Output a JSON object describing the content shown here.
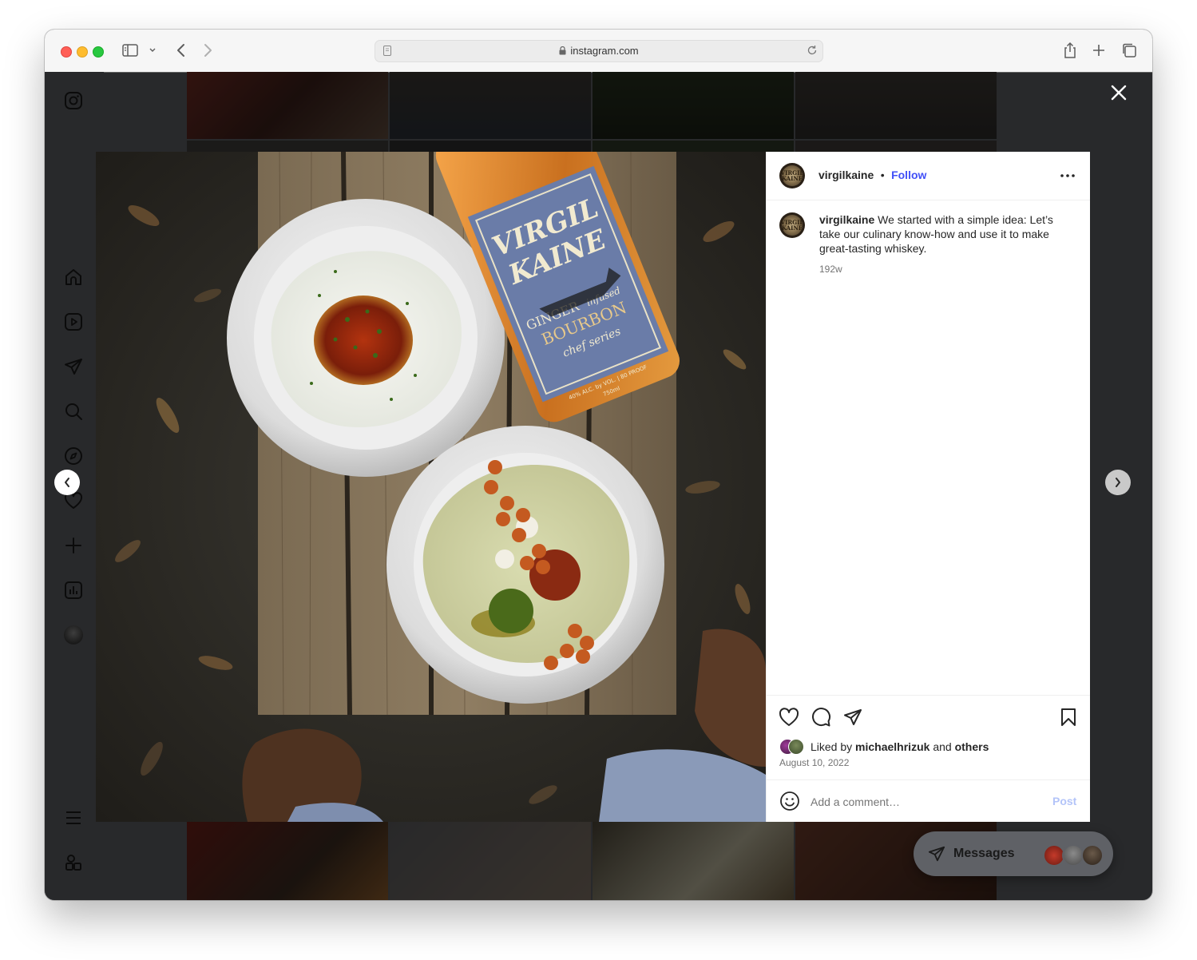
{
  "browser": {
    "url": "instagram.com"
  },
  "post": {
    "username": "virgilkaine",
    "follow_label": "Follow",
    "avatar_text": "VIRGIL KAINE",
    "caption_text": "We started with a simple idea: Let’s take our culinary know-how and use it to make great-tasting whiskey.",
    "caption_age": "192w",
    "liked_by_prefix": "Liked by",
    "liked_by_user": "michaelhrizuk",
    "liked_by_and": "and",
    "liked_by_others": "others",
    "date": "August 10, 2022",
    "comment_placeholder": "Add a comment…",
    "post_label": "Post"
  },
  "photo": {
    "bottle_label_line1": "VIRGIL",
    "bottle_label_line2": "KAINE",
    "bottle_label_line3": "GINGER",
    "bottle_label_line4": "infused",
    "bottle_label_line5": "BOURBON",
    "bottle_label_line6": "chef series",
    "bottle_label_line7": "40% ALC. by VOL. | 80 PROOF",
    "bottle_label_line8": "750ml"
  },
  "messages": {
    "label": "Messages"
  },
  "icons": {
    "sidebar": [
      "instagram-icon",
      "home-icon",
      "reels-icon",
      "messages-icon",
      "search-icon",
      "explore-icon",
      "notifications-icon",
      "create-icon",
      "insights-icon",
      "profile-avatar",
      "more-menu-icon",
      "also-from-meta-icon"
    ],
    "actions": [
      "like-icon",
      "comment-icon",
      "share-icon",
      "save-icon",
      "emoji-icon"
    ]
  },
  "colors": {
    "link_blue": "#4150f7",
    "overlay_bg": "#5a5c61",
    "window_close": "#ff5f57",
    "window_minimize": "#febc2e",
    "window_zoom": "#28c840"
  }
}
